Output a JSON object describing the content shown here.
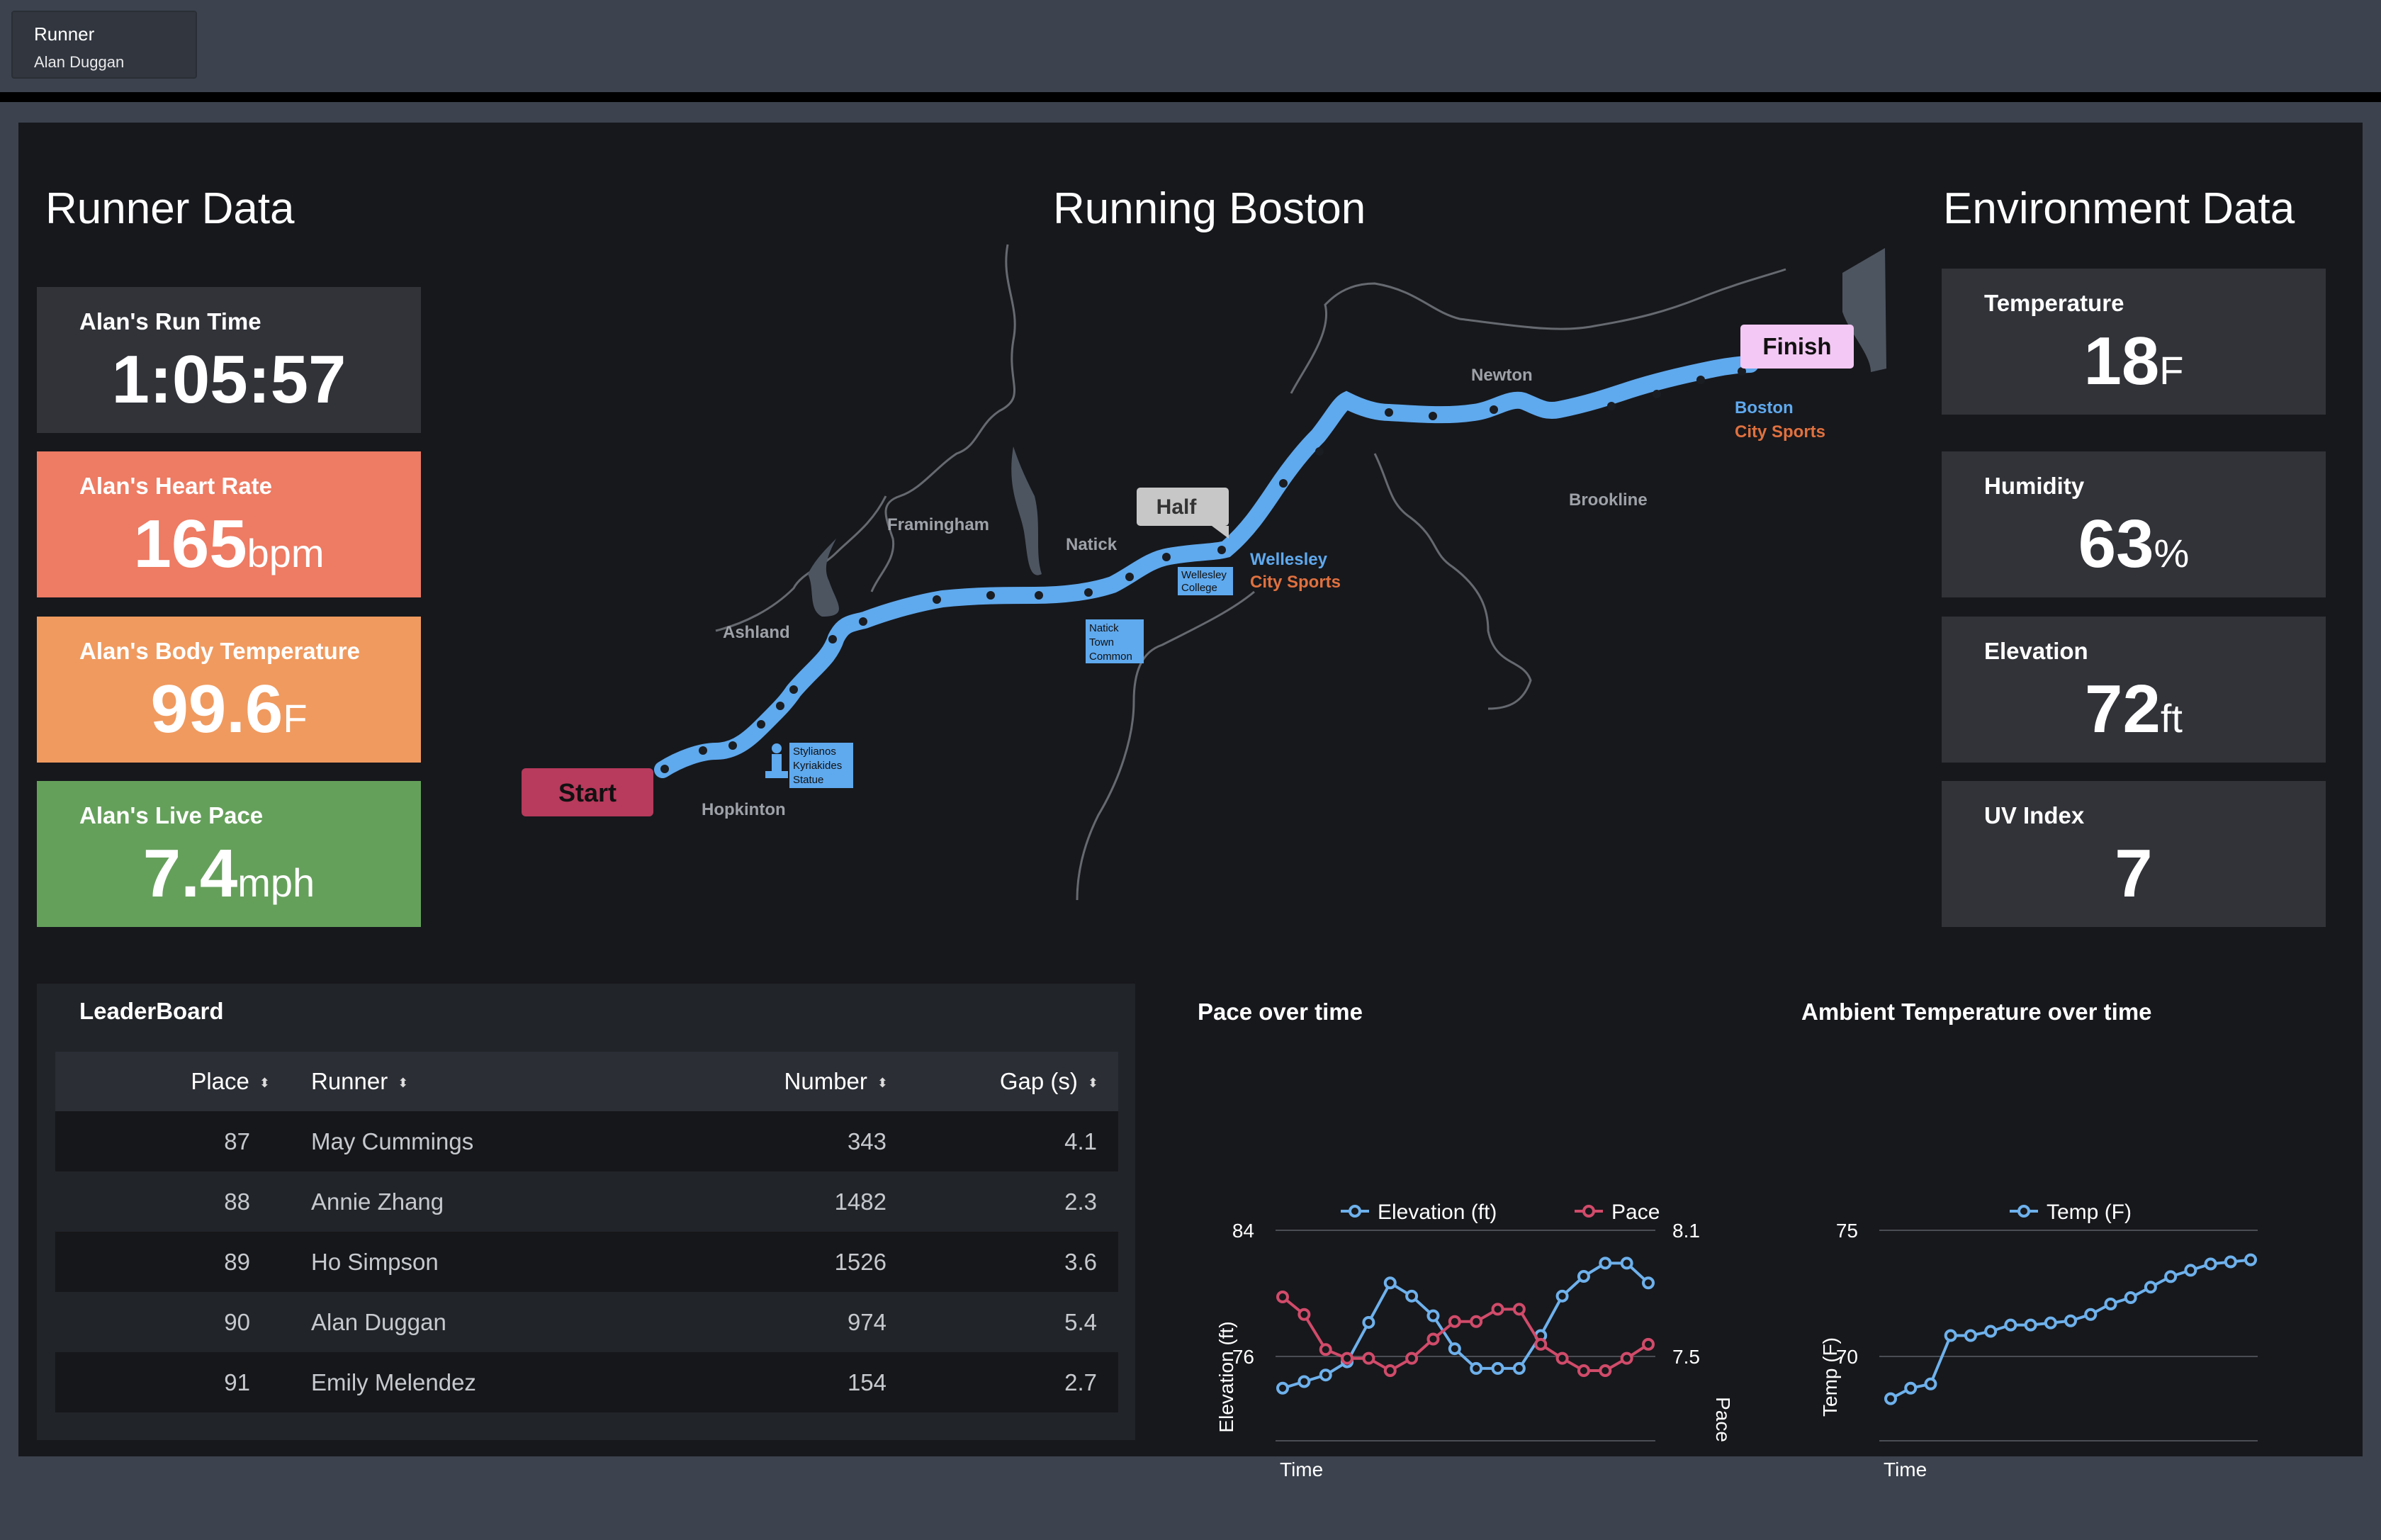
{
  "header": {
    "runner_label": "Runner",
    "runner_value": "Alan Duggan"
  },
  "sections": {
    "runner": "Runner Data",
    "map": "Running Boston",
    "environment": "Environment Data"
  },
  "runner_cards": [
    {
      "title": "Alan's Run Time",
      "value": "1:05:57",
      "unit": "",
      "color": "#313339"
    },
    {
      "title": "Alan's Heart Rate",
      "value": "165",
      "unit": "bpm",
      "color": "#ee7b63"
    },
    {
      "title": "Alan's Body Temperature",
      "value": "99.6",
      "unit": "F",
      "color": "#f09a5f"
    },
    {
      "title": "Alan's Live Pace",
      "value": "7.4",
      "unit": "mph",
      "color": "#65a05b"
    }
  ],
  "environment_cards": [
    {
      "title": "Temperature",
      "value": "18",
      "unit": "F"
    },
    {
      "title": "Humidity",
      "value": "63",
      "unit": "%"
    },
    {
      "title": "Elevation",
      "value": "72",
      "unit": "ft"
    },
    {
      "title": "UV Index",
      "value": "7",
      "unit": ""
    }
  ],
  "map": {
    "start": "Start",
    "half": "Half",
    "finish": "Finish",
    "towns": {
      "framingham": "Framingham",
      "natick": "Natick",
      "ashland": "Ashland",
      "hopkinton": "Hopkinton",
      "newton": "Newton",
      "brookline": "Brookline"
    },
    "wellesley": "Wellesley",
    "wellesley_store": "City Sports",
    "boston": "Boston",
    "boston_store": "City Sports",
    "landmarks": {
      "wellesley_college": [
        "Wellesley",
        "College"
      ],
      "natick_common": [
        "Natick",
        "Town",
        "Common"
      ],
      "statue": [
        "Stylianos",
        "Kyriakides",
        "Statue"
      ]
    },
    "colors": {
      "route": "#5fa9ee",
      "start": "#b83a5c",
      "half": "#c7c7c7",
      "finish": "#f3c8f4",
      "store": "#e0713f",
      "town": "#c0c0c0"
    }
  },
  "leaderboard": {
    "title": "LeaderBoard",
    "columns": [
      "Place",
      "Runner",
      "Number",
      "Gap (s)"
    ],
    "rows": [
      [
        "87",
        "May Cummings",
        "343",
        "4.1"
      ],
      [
        "88",
        "Annie Zhang",
        "1482",
        "2.3"
      ],
      [
        "89",
        "Ho Simpson",
        "1526",
        "3.6"
      ],
      [
        "90",
        "Alan Duggan",
        "974",
        "5.4"
      ],
      [
        "91",
        "Emily Melendez",
        "154",
        "2.7"
      ]
    ]
  },
  "chart_data": [
    {
      "type": "line",
      "title": "Pace over time",
      "xlabel": "Time",
      "ylabel": "Elevation (ft)",
      "y2label": "Pace",
      "ylim": [
        68,
        84
      ],
      "y2lim": [
        6.9,
        8.1
      ],
      "yticks": [
        "84",
        "76"
      ],
      "y2ticks": [
        "8.1",
        "7.5"
      ],
      "legend_position": "top",
      "series": [
        {
          "name": "Elevation (ft)",
          "axis": "left",
          "color": "#6eb1ec",
          "values": [
            72,
            72.5,
            73,
            74,
            77,
            80,
            79,
            77.5,
            75,
            73.5,
            73.5,
            73.5,
            76,
            79,
            80.5,
            81.5,
            81.5,
            80
          ]
        },
        {
          "name": "Pace",
          "axis": "right",
          "color": "#d14b6a",
          "values": [
            7.72,
            7.62,
            7.42,
            7.37,
            7.37,
            7.3,
            7.37,
            7.48,
            7.58,
            7.58,
            7.65,
            7.65,
            7.45,
            7.37,
            7.3,
            7.3,
            7.37,
            7.45
          ]
        }
      ]
    },
    {
      "type": "line",
      "title": "Ambient Temperature over time",
      "xlabel": "Time",
      "ylabel": "Temp (F)",
      "ylim": [
        65,
        75
      ],
      "yticks": [
        "75",
        "70"
      ],
      "legend_position": "top",
      "series": [
        {
          "name": "Temp (F)",
          "color": "#6eb1ec",
          "values": [
            67,
            67.5,
            67.7,
            70,
            70,
            70.2,
            70.5,
            70.5,
            70.6,
            70.7,
            71,
            71.5,
            71.8,
            72.3,
            72.8,
            73.1,
            73.4,
            73.5,
            73.6
          ]
        }
      ]
    }
  ]
}
